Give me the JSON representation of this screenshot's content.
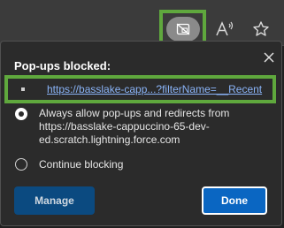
{
  "toolbar": {
    "icons": [
      "popup-blocked-icon",
      "read-aloud-icon",
      "favorite-star-icon"
    ],
    "read_aloud_glyph": "A",
    "read_aloud_sup": "′′"
  },
  "popup_flyout": {
    "title": "Pop-ups blocked:",
    "blocked_items": [
      {
        "link": "https://basslake-capp...?filterName=__Recent"
      }
    ],
    "options": [
      {
        "label": "Always allow pop-ups and redirects from https://basslake-cappuccino-65-dev-ed.scratch.lightning.force.com",
        "selected": true
      },
      {
        "label": "Continue blocking",
        "selected": false
      }
    ],
    "manage_label": "Manage",
    "done_label": "Done"
  },
  "colors": {
    "highlight": "#5fa83d",
    "link": "#8ab4f8",
    "primary_button": "#0a66c2",
    "panel": "#2b2b2b"
  }
}
